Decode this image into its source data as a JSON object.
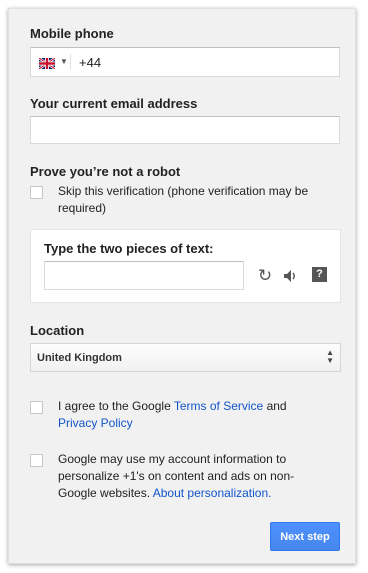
{
  "phone": {
    "label": "Mobile phone",
    "country_flag": "uk-flag-icon",
    "value": "+44"
  },
  "email": {
    "label": "Your current email address",
    "value": ""
  },
  "robot": {
    "label": "Prove you’re not a robot",
    "skip_checkbox_checked": false,
    "skip_line1": "Skip this verification (phone verification may be",
    "skip_line2": "required)",
    "captcha_label": "Type the two pieces of text:",
    "captcha_value": ""
  },
  "location": {
    "label": "Location",
    "selected": "United Kingdom"
  },
  "terms": {
    "checked": false,
    "prefix": "I agree to the Google",
    "link_terms": "Terms of Service",
    "conjunction": "and",
    "link_privacy": "Privacy Policy"
  },
  "personalization": {
    "checked": false,
    "line1": "Google may use my account information to",
    "line2": "personalize +1's on content and ads on non-",
    "line3_text": "Google websites.",
    "line3_link": "About personalization."
  },
  "submit": {
    "label": "Next step"
  },
  "colors": {
    "link": "#1155cc",
    "button": "#4d90fe",
    "panel_bg": "#f1f1f1"
  }
}
